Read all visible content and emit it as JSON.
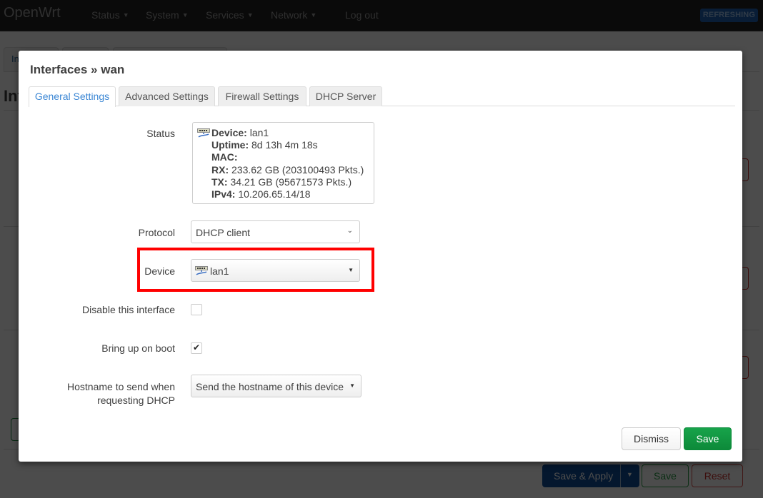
{
  "navbar": {
    "brand": "OpenWrt",
    "menu": [
      {
        "label": "Status",
        "has_dropdown": true
      },
      {
        "label": "System",
        "has_dropdown": true
      },
      {
        "label": "Services",
        "has_dropdown": true
      },
      {
        "label": "Network",
        "has_dropdown": true
      },
      {
        "label": "Log out",
        "has_dropdown": false
      }
    ],
    "status_badge": "REFRESHING"
  },
  "background": {
    "tabs_partial_label": "Int",
    "title_partial": "Int",
    "actions": {
      "save_apply_label": "Save & Apply",
      "save_label": "Save",
      "reset_label": "Reset"
    }
  },
  "modal": {
    "title": "Interfaces » wan",
    "tabs": [
      {
        "label": "General Settings",
        "active": true
      },
      {
        "label": "Advanced Settings",
        "active": false
      },
      {
        "label": "Firewall Settings",
        "active": false
      },
      {
        "label": "DHCP Server",
        "active": false
      }
    ],
    "status": {
      "label": "Status",
      "icon": "ethernet-port-icon",
      "fields": [
        {
          "key": "Device:",
          "value": " lan1"
        },
        {
          "key": "Uptime:",
          "value": " 8d 13h 4m 18s"
        },
        {
          "key": "MAC:",
          "value": ""
        },
        {
          "key": "RX:",
          "value": " 233.62 GB (203100493 Pkts.)"
        },
        {
          "key": "TX:",
          "value": " 34.21 GB (95671573 Pkts.)"
        },
        {
          "key": "IPv4:",
          "value": " 10.206.65.14/18"
        }
      ]
    },
    "protocol": {
      "label": "Protocol",
      "value": "DHCP client"
    },
    "device": {
      "label": "Device",
      "value": "lan1",
      "icon": "ethernet-port-icon"
    },
    "disable_interface": {
      "label": "Disable this interface",
      "checked": false
    },
    "bring_up_on_boot": {
      "label": "Bring up on boot",
      "checked": true
    },
    "hostname": {
      "label_line1": "Hostname to send when",
      "label_line2": "requesting DHCP",
      "value": "Send the hostname of this device"
    },
    "buttons": {
      "dismiss": "Dismiss",
      "save": "Save"
    }
  }
}
